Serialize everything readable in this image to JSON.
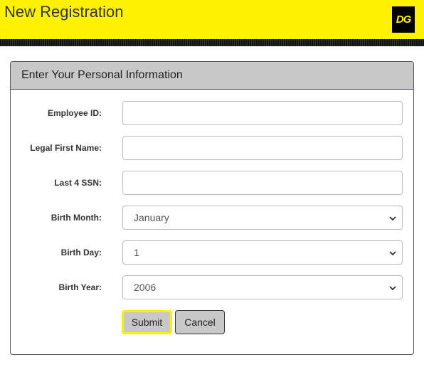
{
  "header": {
    "title": "New Registration",
    "logo_text": "DG",
    "background_color": "#fff200",
    "logo_color": "#000000"
  },
  "panel": {
    "title": "Enter Your Personal Information"
  },
  "form": {
    "employee_id": {
      "label": "Employee ID:",
      "value": ""
    },
    "first_name": {
      "label": "Legal First Name:",
      "value": ""
    },
    "ssn_last4": {
      "label": "Last 4 SSN:",
      "value": ""
    },
    "birth_month": {
      "label": "Birth Month:",
      "selected": "January"
    },
    "birth_day": {
      "label": "Birth Day:",
      "selected": "1"
    },
    "birth_year": {
      "label": "Birth Year:",
      "selected": "2006"
    }
  },
  "buttons": {
    "submit_label": "Submit",
    "cancel_label": "Cancel",
    "submit_border_color": "#fff200"
  },
  "icons": {
    "select_arrow": "chevron-down-icon"
  }
}
